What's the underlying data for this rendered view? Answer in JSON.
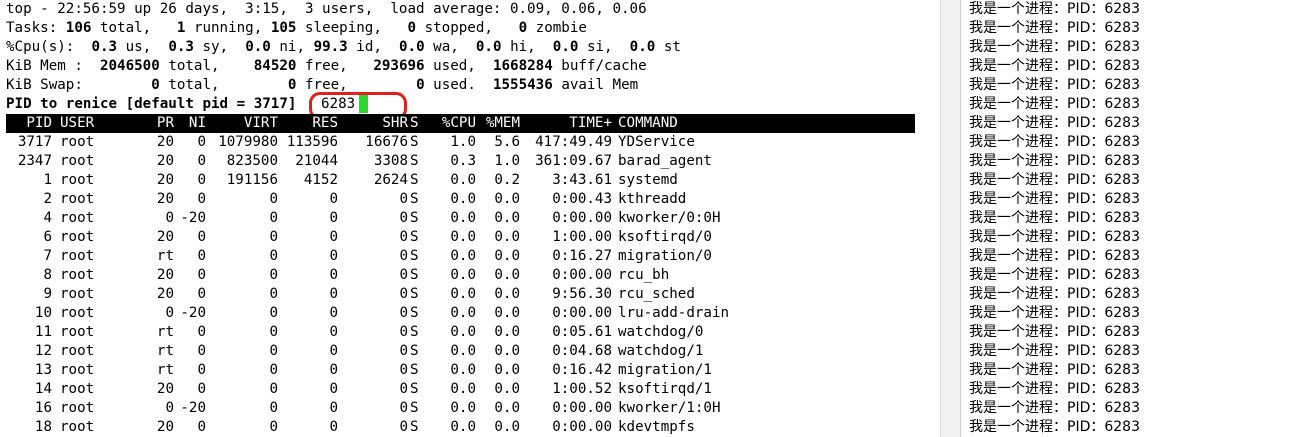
{
  "summary": {
    "line1": "top - 22:56:59 up 26 days,  3:15,  3 users,  load average: 0.09, 0.06, 0.06",
    "tasks": {
      "label": "Tasks:",
      "total": "106",
      "total_lbl": "total,",
      "running": "1",
      "running_lbl": "running,",
      "sleeping": "105",
      "sleeping_lbl": "sleeping,",
      "stopped": "0",
      "stopped_lbl": "stopped,",
      "zombie": "0",
      "zombie_lbl": "zombie"
    },
    "cpu": {
      "label": "%Cpu(s):",
      "us": "0.3",
      "us_lbl": "us,",
      "sy": "0.3",
      "sy_lbl": "sy,",
      "ni": "0.0",
      "ni_lbl": "ni,",
      "id": "99.3",
      "id_lbl": "id,",
      "wa": "0.0",
      "wa_lbl": "wa,",
      "hi": "0.0",
      "hi_lbl": "hi,",
      "si": "0.0",
      "si_lbl": "si,",
      "st": "0.0",
      "st_lbl": "st"
    },
    "mem": {
      "label": "KiB Mem :",
      "total": "2046500",
      "total_lbl": "total,",
      "free": "84520",
      "free_lbl": "free,",
      "used": "293696",
      "used_lbl": "used,",
      "cache": "1668284",
      "cache_lbl": "buff/cache"
    },
    "swap": {
      "label": "KiB Swap:",
      "total": "0",
      "total_lbl": "total,",
      "free": "0",
      "free_lbl": "free,",
      "used": "0",
      "used_lbl": "used.",
      "avail": "1555436",
      "avail_lbl": "avail Mem"
    }
  },
  "prompt": {
    "text": "PID to renice [default pid = 3717]",
    "input_value": "6283"
  },
  "columns": [
    "PID",
    "USER",
    "PR",
    "NI",
    "VIRT",
    "RES",
    "SHR",
    "S",
    "%CPU",
    "%MEM",
    "TIME+",
    "COMMAND"
  ],
  "processes": [
    [
      "3717",
      "root",
      "20",
      "0",
      "1079980",
      "113596",
      "16676",
      "S",
      "1.0",
      "5.6",
      "417:49.49",
      "YDService"
    ],
    [
      "2347",
      "root",
      "20",
      "0",
      "823500",
      "21044",
      "3308",
      "S",
      "0.3",
      "1.0",
      "361:09.67",
      "barad_agent"
    ],
    [
      "1",
      "root",
      "20",
      "0",
      "191156",
      "4152",
      "2624",
      "S",
      "0.0",
      "0.2",
      "3:43.61",
      "systemd"
    ],
    [
      "2",
      "root",
      "20",
      "0",
      "0",
      "0",
      "0",
      "S",
      "0.0",
      "0.0",
      "0:00.43",
      "kthreadd"
    ],
    [
      "4",
      "root",
      "0",
      "-20",
      "0",
      "0",
      "0",
      "S",
      "0.0",
      "0.0",
      "0:00.00",
      "kworker/0:0H"
    ],
    [
      "6",
      "root",
      "20",
      "0",
      "0",
      "0",
      "0",
      "S",
      "0.0",
      "0.0",
      "1:00.00",
      "ksoftirqd/0"
    ],
    [
      "7",
      "root",
      "rt",
      "0",
      "0",
      "0",
      "0",
      "S",
      "0.0",
      "0.0",
      "0:16.27",
      "migration/0"
    ],
    [
      "8",
      "root",
      "20",
      "0",
      "0",
      "0",
      "0",
      "S",
      "0.0",
      "0.0",
      "0:00.00",
      "rcu_bh"
    ],
    [
      "9",
      "root",
      "20",
      "0",
      "0",
      "0",
      "0",
      "S",
      "0.0",
      "0.0",
      "9:56.30",
      "rcu_sched"
    ],
    [
      "10",
      "root",
      "0",
      "-20",
      "0",
      "0",
      "0",
      "S",
      "0.0",
      "0.0",
      "0:00.00",
      "lru-add-drain"
    ],
    [
      "11",
      "root",
      "rt",
      "0",
      "0",
      "0",
      "0",
      "S",
      "0.0",
      "0.0",
      "0:05.61",
      "watchdog/0"
    ],
    [
      "12",
      "root",
      "rt",
      "0",
      "0",
      "0",
      "0",
      "S",
      "0.0",
      "0.0",
      "0:04.68",
      "watchdog/1"
    ],
    [
      "13",
      "root",
      "rt",
      "0",
      "0",
      "0",
      "0",
      "S",
      "0.0",
      "0.0",
      "0:16.42",
      "migration/1"
    ],
    [
      "14",
      "root",
      "20",
      "0",
      "0",
      "0",
      "0",
      "S",
      "0.0",
      "0.0",
      "1:00.52",
      "ksoftirqd/1"
    ],
    [
      "16",
      "root",
      "0",
      "-20",
      "0",
      "0",
      "0",
      "S",
      "0.0",
      "0.0",
      "0:00.00",
      "kworker/1:0H"
    ],
    [
      "18",
      "root",
      "20",
      "0",
      "0",
      "0",
      "0",
      "S",
      "0.0",
      "0.0",
      "0:00.00",
      "kdevtmpfs"
    ]
  ],
  "right_log": [
    "我是一个进程：PID：6283",
    "我是一个进程：PID：6283",
    "我是一个进程：PID：6283",
    "我是一个进程：PID：6283",
    "我是一个进程：PID：6283",
    "我是一个进程：PID：6283",
    "我是一个进程：PID：6283",
    "我是一个进程：PID：6283",
    "我是一个进程：PID：6283",
    "我是一个进程：PID：6283",
    "我是一个进程：PID：6283",
    "我是一个进程：PID：6283",
    "我是一个进程：PID：6283",
    "我是一个进程：PID：6283",
    "我是一个进程：PID：6283",
    "我是一个进程：PID：6283",
    "我是一个进程：PID：6283",
    "我是一个进程：PID：6283",
    "我是一个进程：PID：6283",
    "我是一个进程：PID：6283",
    "我是一个进程：PID：6283",
    "我是一个进程：PID：6283",
    "我是一个进程：PID：6283"
  ],
  "colors": {
    "cursor": "#2bd82b",
    "annotation": "#e21f1f",
    "header_bg": "#000000",
    "header_fg": "#ffffff"
  }
}
